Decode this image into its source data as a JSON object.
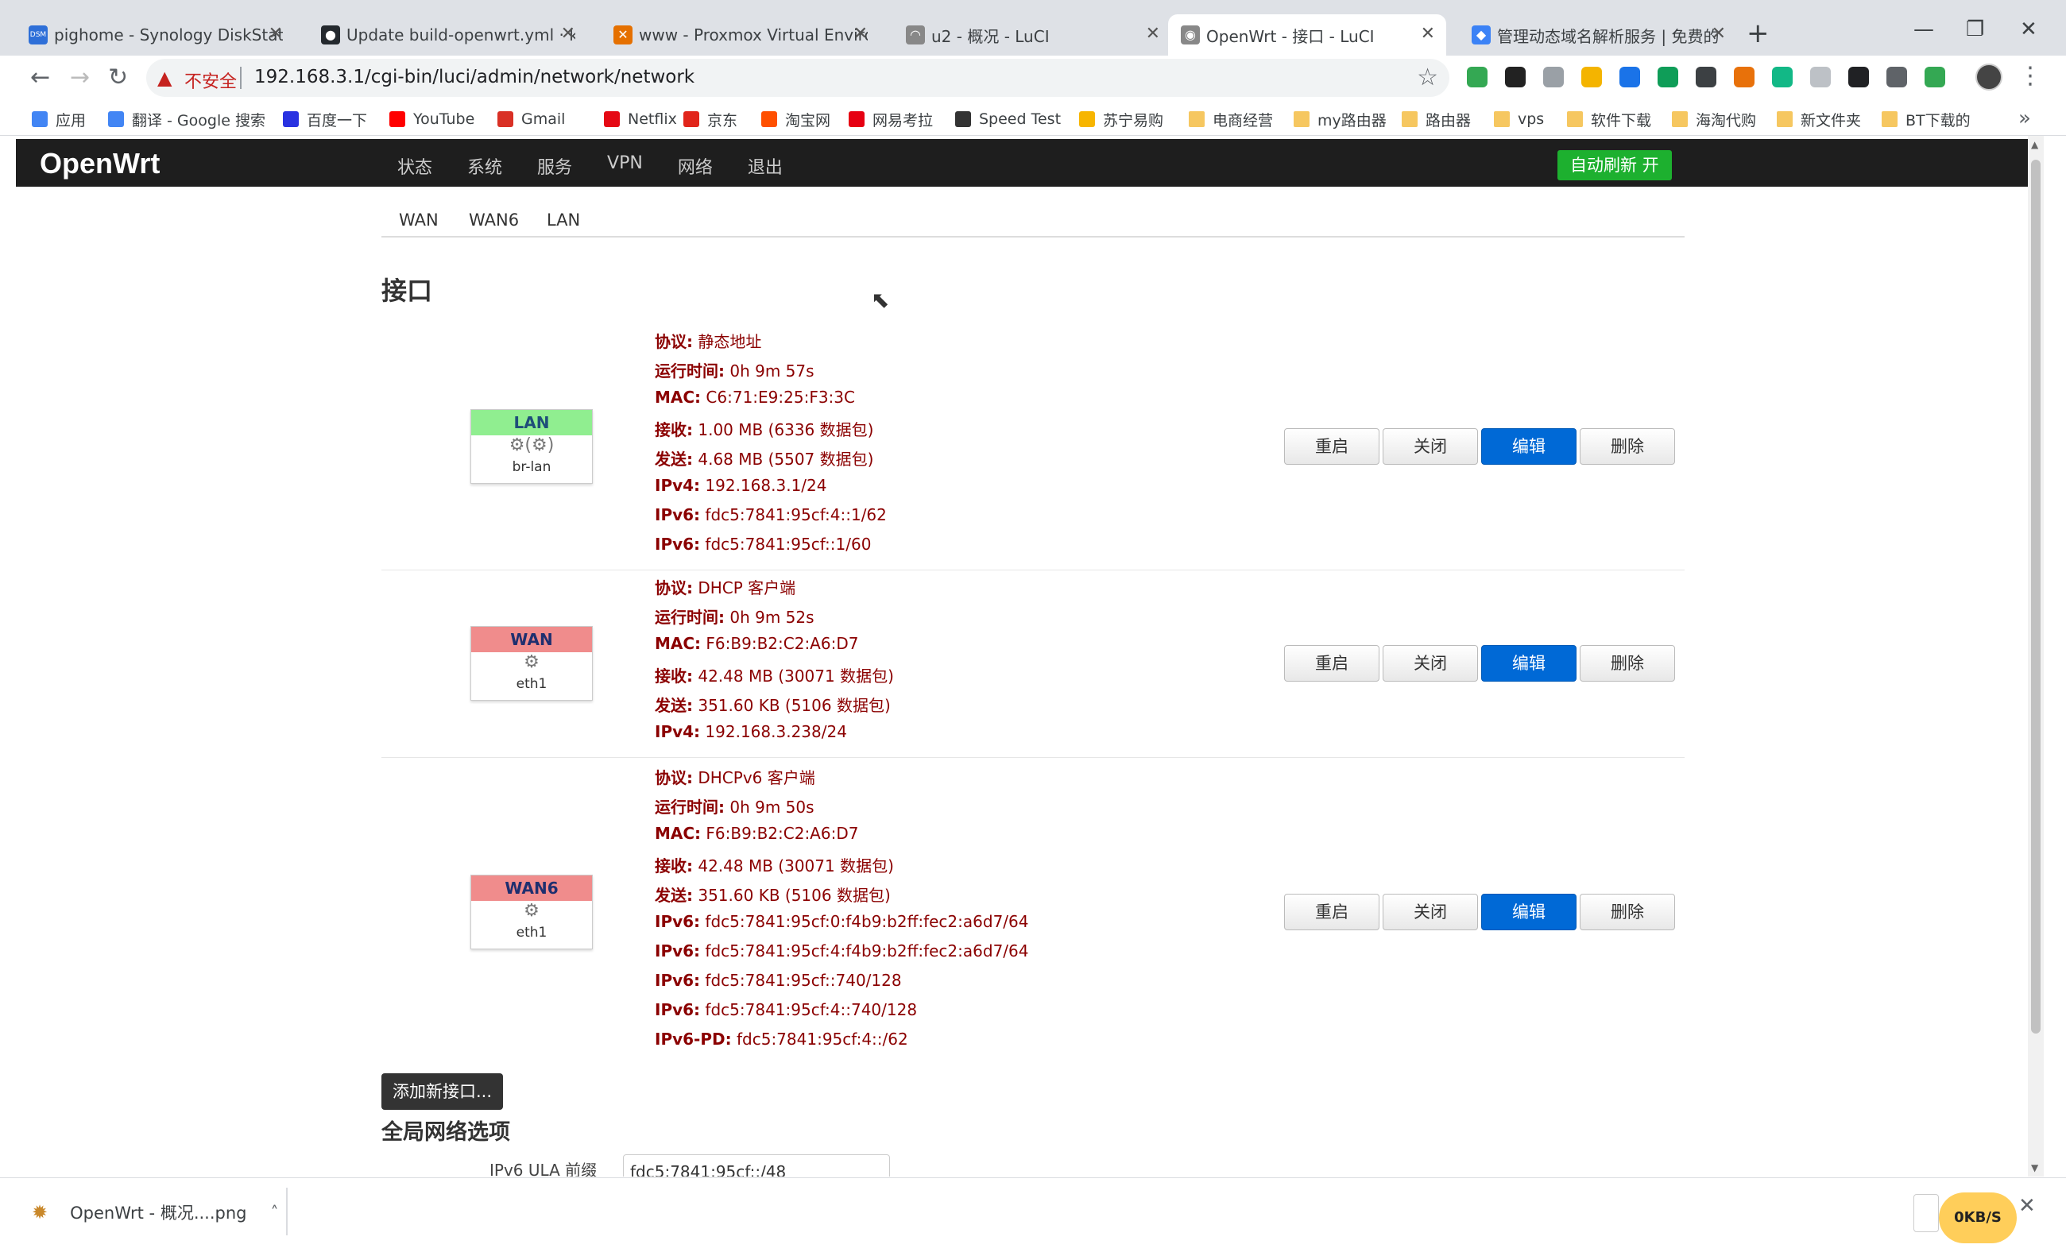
{
  "browser": {
    "tabs": [
      {
        "title": "pighome - Synology DiskStatio",
        "icon": "dsm-icon",
        "color": "#2e6fd8",
        "glyph": "DSM"
      },
      {
        "title": "Update build-openwrt.yml · ke",
        "icon": "github-icon",
        "color": "#24292e",
        "glyph": "●"
      },
      {
        "title": "www - Proxmox Virtual Enviror",
        "icon": "proxmox-icon",
        "color": "#e57000",
        "glyph": "✕"
      },
      {
        "title": "u2 - 概况 - LuCI",
        "icon": "luci-icon",
        "color": "#888888",
        "glyph": "◠"
      },
      {
        "title": "OpenWrt - 接口 - LuCI",
        "icon": "luci-icon",
        "color": "#888888",
        "glyph": "◉"
      },
      {
        "title": "管理动态域名解析服务 | 免费的",
        "icon": "ddns-icon",
        "color": "#3b82f6",
        "glyph": "◆"
      }
    ],
    "new_tab": "+",
    "url_warning": "不安全",
    "url": "192.168.3.1/cgi-bin/luci/admin/network/network",
    "bookmarks": [
      {
        "label": "应用",
        "icon": "apps-icon",
        "color": "#4285f4"
      },
      {
        "label": "翻译 - Google 搜索",
        "icon": "google-icon",
        "color": "#4285f4"
      },
      {
        "label": "百度一下",
        "icon": "baidu-icon",
        "color": "#2932e1"
      },
      {
        "label": "YouTube",
        "icon": "youtube-icon",
        "color": "#ff0000"
      },
      {
        "label": "Gmail",
        "icon": "gmail-icon",
        "color": "#d93025"
      },
      {
        "label": "Netflix",
        "icon": "netflix-icon",
        "color": "#e50914"
      },
      {
        "label": "京东",
        "icon": "jd-icon",
        "color": "#e1251b"
      },
      {
        "label": "淘宝网",
        "icon": "taobao-icon",
        "color": "#ff5000"
      },
      {
        "label": "网易考拉",
        "icon": "kaola-icon",
        "color": "#e60012"
      },
      {
        "label": "Speed Test",
        "icon": "speedtest-icon",
        "color": "#333333"
      },
      {
        "label": "苏宁易购",
        "icon": "suning-icon",
        "color": "#f7b500"
      },
      {
        "label": "电商经营",
        "icon": "folder-icon",
        "color": "#f6c760"
      },
      {
        "label": "my路由器",
        "icon": "folder-icon",
        "color": "#f6c760"
      },
      {
        "label": "路由器",
        "icon": "folder-icon",
        "color": "#f6c760"
      },
      {
        "label": "vps",
        "icon": "folder-icon",
        "color": "#f6c760"
      },
      {
        "label": "软件下载",
        "icon": "folder-icon",
        "color": "#f6c760"
      },
      {
        "label": "海淘代购",
        "icon": "folder-icon",
        "color": "#f6c760"
      },
      {
        "label": "新文件夹",
        "icon": "folder-icon",
        "color": "#f6c760"
      },
      {
        "label": "BT下载的",
        "icon": "folder-icon",
        "color": "#f6c760"
      }
    ],
    "more_bookmarks": "»"
  },
  "app": {
    "brand": "OpenWrt",
    "nav": [
      "状态",
      "系统",
      "服务",
      "VPN",
      "网络",
      "退出"
    ],
    "auto_refresh": "自动刷新 开",
    "subtabs": [
      "WAN",
      "WAN6",
      "LAN"
    ],
    "section_title": "接口",
    "buttons": {
      "restart": "重启",
      "stop": "关闭",
      "edit": "编辑",
      "delete": "删除"
    },
    "interfaces": [
      {
        "name": "LAN",
        "device": "br-lan",
        "header_color": "#90ee90",
        "icons": "⚙(⚙)",
        "info": [
          {
            "k": "协议:",
            "v": "静态地址"
          },
          {
            "k": "运行时间:",
            "v": "0h 9m 57s"
          },
          {
            "k": "MAC:",
            "v": "C6:71:E9:25:F3:3C"
          },
          {
            "k": "接收:",
            "v": "1.00 MB (6336 数据包)"
          },
          {
            "k": "发送:",
            "v": "4.68 MB (5507 数据包)"
          },
          {
            "k": "IPv4:",
            "v": "192.168.3.1/24"
          },
          {
            "k": "IPv6:",
            "v": "fdc5:7841:95cf:4::1/62"
          },
          {
            "k": "IPv6:",
            "v": "fdc5:7841:95cf::1/60"
          }
        ]
      },
      {
        "name": "WAN",
        "device": "eth1",
        "header_color": "#f08c8c",
        "icons": "⚙",
        "info": [
          {
            "k": "协议:",
            "v": "DHCP 客户端"
          },
          {
            "k": "运行时间:",
            "v": "0h 9m 52s"
          },
          {
            "k": "MAC:",
            "v": "F6:B9:B2:C2:A6:D7"
          },
          {
            "k": "接收:",
            "v": "42.48 MB (30071 数据包)"
          },
          {
            "k": "发送:",
            "v": "351.60 KB (5106 数据包)"
          },
          {
            "k": "IPv4:",
            "v": "192.168.3.238/24"
          }
        ]
      },
      {
        "name": "WAN6",
        "device": "eth1",
        "header_color": "#f08c8c",
        "icons": "⚙",
        "info": [
          {
            "k": "协议:",
            "v": "DHCPv6 客户端"
          },
          {
            "k": "运行时间:",
            "v": "0h 9m 50s"
          },
          {
            "k": "MAC:",
            "v": "F6:B9:B2:C2:A6:D7"
          },
          {
            "k": "接收:",
            "v": "42.48 MB (30071 数据包)"
          },
          {
            "k": "发送:",
            "v": "351.60 KB (5106 数据包)"
          },
          {
            "k": "IPv6:",
            "v": "fdc5:7841:95cf:0:f4b9:b2ff:fec2:a6d7/64"
          },
          {
            "k": "IPv6:",
            "v": "fdc5:7841:95cf:4:f4b9:b2ff:fec2:a6d7/64"
          },
          {
            "k": "IPv6:",
            "v": "fdc5:7841:95cf::740/128"
          },
          {
            "k": "IPv6:",
            "v": "fdc5:7841:95cf:4::740/128"
          },
          {
            "k": "IPv6-PD:",
            "v": "fdc5:7841:95cf:4::/62"
          }
        ]
      }
    ],
    "add_interface": "添加新接口...",
    "global_title": "全局网络选项",
    "ula_label": "IPv6 ULA 前缀",
    "ula_value": "fdc5:7841:95cf::/48"
  },
  "downloads": {
    "file": "OpenWrt - 概况....png",
    "speed": "0KB/S"
  }
}
